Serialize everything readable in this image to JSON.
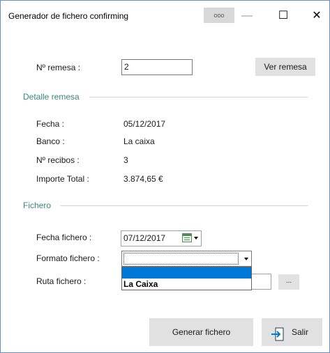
{
  "window": {
    "title": "Generador de fichero confirming",
    "dots_label": "ooo",
    "minimize_glyph": "—",
    "maximize_glyph": "☐",
    "close_glyph": "✕"
  },
  "remesa": {
    "label": "Nº remesa :",
    "value": "2",
    "ver_button": "Ver remesa"
  },
  "detalle": {
    "section_title": "Detalle remesa",
    "fecha_label": "Fecha :",
    "fecha_value": "05/12/2017",
    "banco_label": "Banco :",
    "banco_value": "La caixa",
    "recibos_label": "Nº recibos :",
    "recibos_value": "3",
    "importe_label": "Importe Total :",
    "importe_value": "3.874,65 €"
  },
  "fichero": {
    "section_title": "Fichero",
    "fecha_label": "Fecha fichero :",
    "fecha_value": "07/12/2017",
    "formato_label": "Formato fichero :",
    "formato_value": "",
    "formato_options": [
      "",
      "La Caixa"
    ],
    "ruta_label": "Ruta fichero :",
    "ruta_value": "",
    "browse_label": "..."
  },
  "actions": {
    "generar_label": "Generar fichero",
    "salir_label": "Salir"
  }
}
